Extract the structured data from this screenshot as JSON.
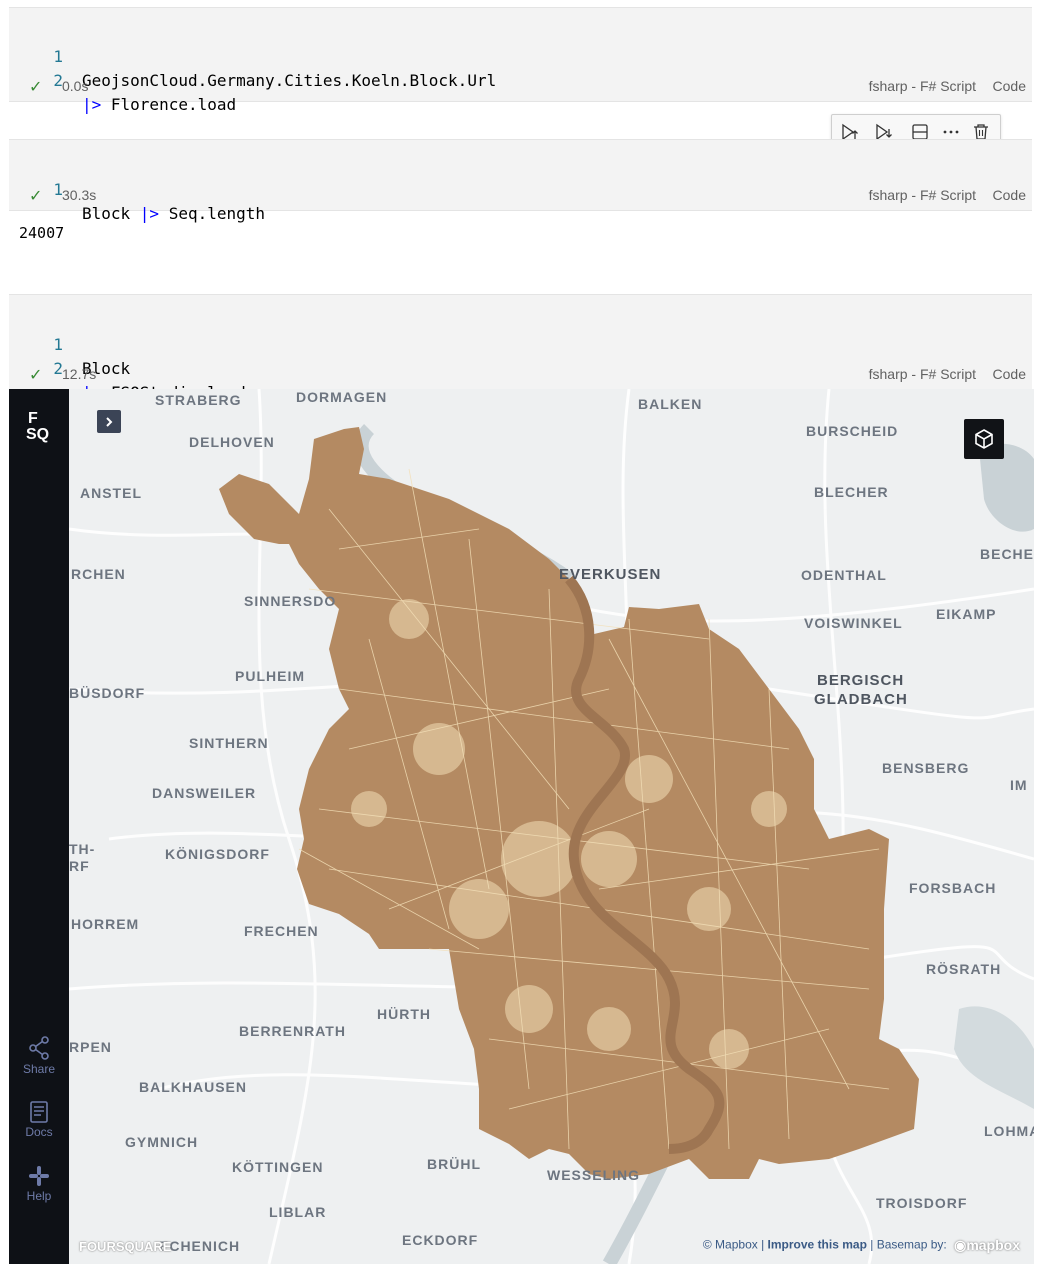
{
  "cells": [
    {
      "lines": [
        {
          "num": "1",
          "text": "GeojsonCloud.Germany.Cities.Koeln.Block.Url"
        },
        {
          "num": "2",
          "pipe": "|>",
          "text": " Florence.load"
        }
      ],
      "time": "0.0s",
      "language": "fsharp - F# Script",
      "kind": "Code"
    },
    {
      "lines": [
        {
          "num": "1",
          "pre": "Block ",
          "pipe": "|>",
          "text": " Seq.length"
        }
      ],
      "time": "30.3s",
      "language": "fsharp - F# Script",
      "kind": "Code",
      "output": "24007"
    },
    {
      "lines": [
        {
          "num": "1",
          "text": "Block"
        },
        {
          "num": "2",
          "pipe": "|>",
          "text": " FSQStudio.load"
        }
      ],
      "time": "12.7s",
      "language": "fsharp - F# Script",
      "kind": "Code"
    }
  ],
  "toolbar": {
    "icons": [
      "run-above-icon",
      "run-below-icon",
      "split-cell-icon",
      "more-icon",
      "delete-icon"
    ]
  },
  "map": {
    "logo_line1": "F",
    "logo_line2": "SQ",
    "sidebar": [
      {
        "label": "Share",
        "icon": "share-icon"
      },
      {
        "label": "Docs",
        "icon": "docs-icon"
      },
      {
        "label": "Help",
        "icon": "help-icon"
      }
    ],
    "places": [
      "STRABERG",
      "DORMAGEN",
      "BALKEN",
      "BURSCHEID",
      "DELHOVEN",
      "ANSTEL",
      "BLECHER",
      "RCHEN",
      "EVERKUSEN",
      "ODENTHAL",
      "BECHE",
      "SINNERSDO",
      "VOISWINKEL",
      "EIKAMP",
      "PULHEIM",
      "BERGISCH",
      "GLADBACH",
      "BÜSDORF",
      "SINTHERN",
      "BENSBERG",
      "IM",
      "DANSWEILER",
      "TH-",
      "RF",
      "KÖNIGSDORF",
      "FORSBACH",
      "HORREM",
      "FRECHEN",
      "RÖSRATH",
      "HÜRTH",
      "BERRENRATH",
      "RPEN",
      "BALKHAUSEN",
      "LOHMA",
      "GYMNICH",
      "KÖTTINGEN",
      "BRÜHL",
      "WESSELING",
      "TROISDORF",
      "LIBLAR",
      "ECHENICH",
      "ECKDORF"
    ],
    "watermark": "FOURSQUARE",
    "attribution": {
      "mapbox": "© Mapbox",
      "improve": "Improve this map",
      "basemap": "Basemap by:",
      "mapbox_logo": "mapbox"
    },
    "fill_color": "#b48a62",
    "block_line_color": "#f3dfb7",
    "water_color": "#c9d2d6"
  }
}
